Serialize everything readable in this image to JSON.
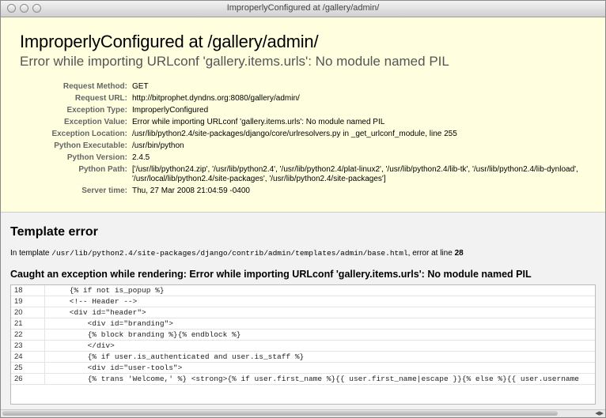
{
  "window": {
    "title": "ImproperlyConfigured at /gallery/admin/"
  },
  "error": {
    "title": "ImproperlyConfigured at /gallery/admin/",
    "subtitle": "Error while importing URLconf 'gallery.items.urls': No module named PIL"
  },
  "meta": [
    {
      "label": "Request Method:",
      "value": "GET"
    },
    {
      "label": "Request URL:",
      "value": "http://bitprophet.dyndns.org:8080/gallery/admin/"
    },
    {
      "label": "Exception Type:",
      "value": "ImproperlyConfigured"
    },
    {
      "label": "Exception Value:",
      "value": "Error while importing URLconf 'gallery.items.urls': No module named PIL"
    },
    {
      "label": "Exception Location:",
      "value": "/usr/lib/python2.4/site-packages/django/core/urlresolvers.py in _get_urlconf_module, line 255"
    },
    {
      "label": "Python Executable:",
      "value": "/usr/bin/python"
    },
    {
      "label": "Python Version:",
      "value": "2.4.5"
    },
    {
      "label": "Python Path:",
      "value": "['/usr/lib/python24.zip', '/usr/lib/python2.4', '/usr/lib/python2.4/plat-linux2', '/usr/lib/python2.4/lib-tk', '/usr/lib/python2.4/lib-dynload', '/usr/local/lib/python2.4/site-packages', '/usr/lib/python2.4/site-packages']"
    },
    {
      "label": "Server time:",
      "value": "Thu, 27 Mar 2008 21:04:59 -0400"
    }
  ],
  "template_error": {
    "heading": "Template error",
    "intro_prefix": "In template ",
    "template_path": "/usr/lib/python2.4/site-packages/django/contrib/admin/templates/admin/base.html",
    "intro_mid": ", error at line ",
    "line": "28",
    "exception": "Caught an exception while rendering: Error while importing URLconf 'gallery.items.urls': No module named PIL"
  },
  "code_lines": [
    {
      "n": "18",
      "code": "    {% if not is_popup %}"
    },
    {
      "n": "19",
      "code": "    <!-- Header -->"
    },
    {
      "n": "20",
      "code": "    <div id=\"header\">"
    },
    {
      "n": "21",
      "code": "        <div id=\"branding\">"
    },
    {
      "n": "22",
      "code": "        {% block branding %}{% endblock %}"
    },
    {
      "n": "23",
      "code": "        </div>"
    },
    {
      "n": "24",
      "code": "        {% if user.is_authenticated and user.is_staff %}"
    },
    {
      "n": "25",
      "code": "        <div id=\"user-tools\">"
    },
    {
      "n": "26",
      "code": "        {% trans 'Welcome,' %} <strong>{% if user.first_name %}{{ user.first_name|escape }}{% else %}{{ user.username"
    }
  ]
}
